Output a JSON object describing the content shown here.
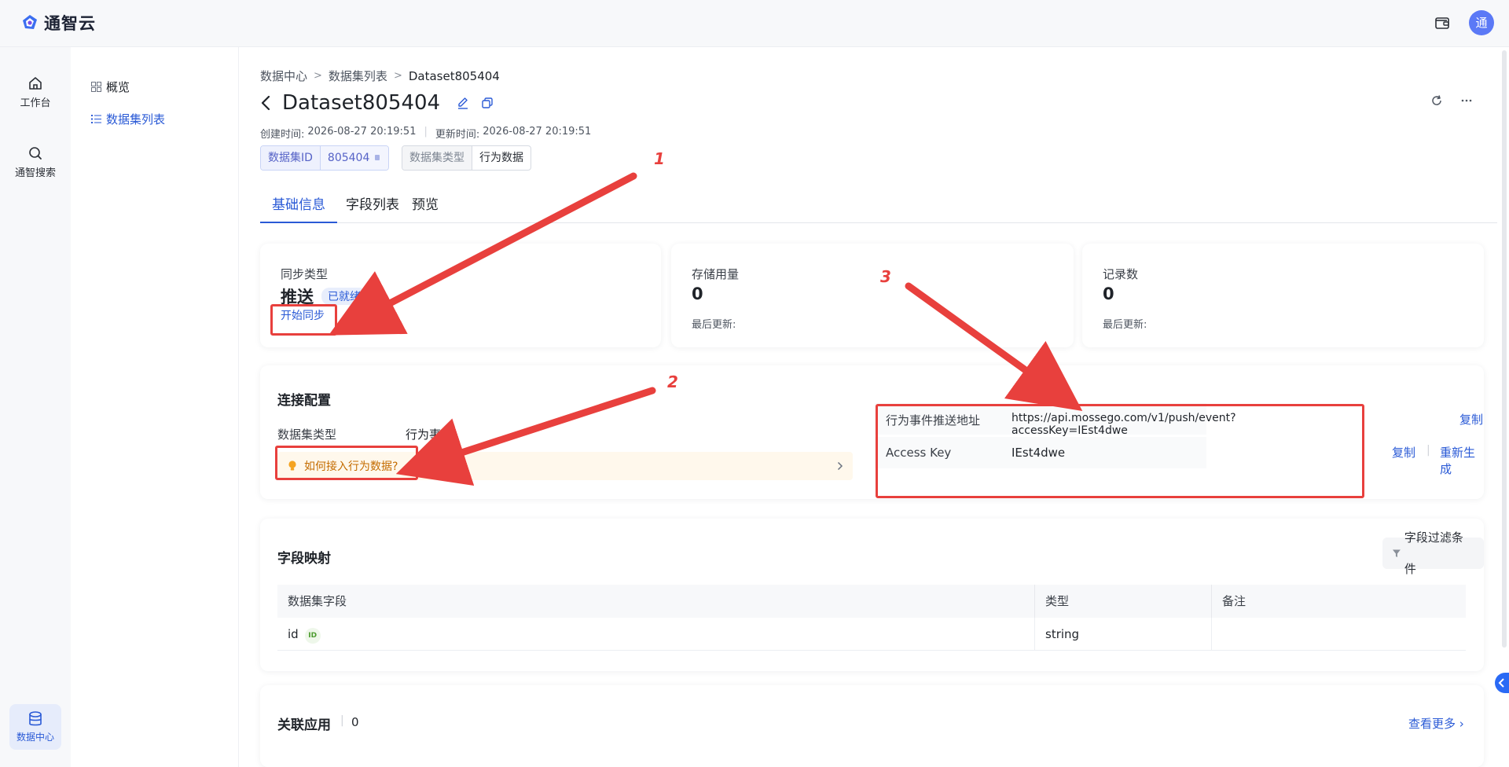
{
  "app": {
    "logo_text": "通智云",
    "avatar_text": "通"
  },
  "rail": {
    "workbench_label": "工作台",
    "search_label": "通智搜索",
    "data_center_label": "数据中心"
  },
  "subnav": {
    "overview_label": "概览",
    "dataset_list_label": "数据集列表"
  },
  "breadcrumb": {
    "level1": "数据中心",
    "level2": "数据集列表",
    "current": "Dataset805404"
  },
  "dataset": {
    "title": "Dataset805404",
    "created_label": "创建时间:",
    "created_value": "2026-08-27 20:19:51",
    "updated_label": "更新时间:",
    "updated_value": "2026-08-27 20:19:51",
    "id_key": "数据集ID",
    "id_value": "805404",
    "type_key": "数据集类型",
    "type_value": "行为数据"
  },
  "tabs": [
    "基础信息",
    "字段列表",
    "预览"
  ],
  "stats": {
    "sync_label": "同步类型",
    "sync_value": "推送",
    "sync_badge": "已就绪",
    "sync_action": "开始同步",
    "storage_label": "存储用量",
    "storage_value": "0",
    "storage_updated": "最后更新:",
    "records_label": "记录数",
    "records_value": "0",
    "records_updated": "最后更新:"
  },
  "connection": {
    "title": "连接配置",
    "type_label": "数据集类型",
    "type_value": "行为事件",
    "hint": "如何接入行为数据?",
    "push_url_label": "行为事件推送地址",
    "push_url_value": "https://api.mossego.com/v1/push/event?accessKey=IEst4dwe",
    "access_key_label": "Access Key",
    "access_key_value": "IEst4dwe",
    "copy_label": "复制",
    "regenerate_label": "重新生成"
  },
  "mapping": {
    "title": "字段映射",
    "filter_label": "字段过滤条件",
    "columns": [
      "数据集字段",
      "类型",
      "备注"
    ],
    "rows": [
      {
        "field": "id",
        "badge": "ID",
        "type": "string",
        "note": ""
      }
    ]
  },
  "related": {
    "title": "关联应用",
    "count": "0",
    "more_label": "查看更多"
  },
  "annotations": [
    "1",
    "2",
    "3"
  ],
  "colors": {
    "accent": "#2a5ad6",
    "annotation": "#e8403d",
    "hint_text": "#c46c00"
  }
}
